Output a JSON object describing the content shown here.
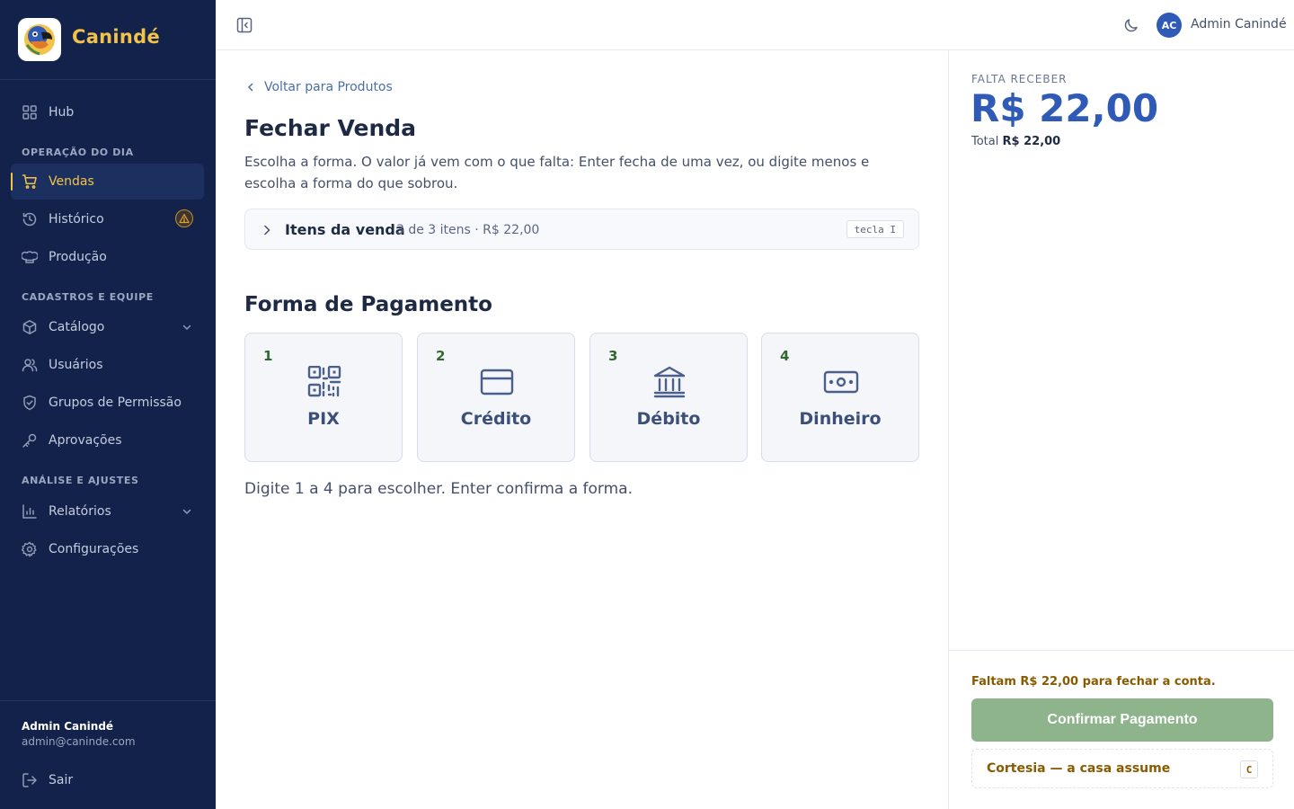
{
  "sidebar": {
    "brand": "Canindé",
    "items": {
      "hub": "Hub",
      "vendas": "Vendas",
      "historico": "Histórico",
      "producao": "Produção",
      "catalogo": "Catálogo",
      "usuarios": "Usuários",
      "grupos": "Grupos de Permissão",
      "aprovacoes": "Aprovações",
      "relatorios": "Relatórios",
      "configuracoes": "Configurações"
    },
    "sections": {
      "operacao": "OPERAÇÃO DO DIA",
      "cadastros": "CADASTROS E EQUIPE",
      "analise": "ANÁLISE E AJUSTES"
    },
    "active_item": "Vendas",
    "footer": {
      "user_name": "Admin Canindé",
      "user_email": "admin@caninde.com",
      "logout": "Sair"
    }
  },
  "topbar": {
    "avatar_initials": "AC",
    "user_name": "Admin Canindé"
  },
  "main": {
    "back_link": "Voltar para Produtos",
    "title": "Fechar Venda",
    "description": "Escolha a forma. O valor já vem com o que falta: Enter fecha de uma vez, ou digite menos e escolha a forma do que sobrou.",
    "items_box": {
      "title": "Itens da venda",
      "meta": "3 de 3 itens · R$ 22,00",
      "shortcut": "tecla I"
    },
    "payment_section_title": "Forma de Pagamento",
    "payment_methods": [
      {
        "key": "1",
        "label": "PIX",
        "icon": "qr-code-icon"
      },
      {
        "key": "2",
        "label": "Crédito",
        "icon": "credit-card-icon"
      },
      {
        "key": "3",
        "label": "Débito",
        "icon": "bank-icon"
      },
      {
        "key": "4",
        "label": "Dinheiro",
        "icon": "banknote-icon"
      }
    ],
    "hint": "Digite 1 a 4 para escolher. Enter confirma a forma."
  },
  "summary": {
    "due_label": "FALTA RECEBER",
    "due_amount": "R$ 22,00",
    "total_label": "Total",
    "total_value": "R$ 22,00",
    "remaining_message": "Faltam R$ 22,00 para fechar a conta.",
    "confirm_button": "Confirmar Pagamento",
    "courtesy_button": "Cortesia — a casa assume",
    "courtesy_shortcut": "C"
  },
  "colors": {
    "sidebar_bg": "#13224a",
    "accent_yellow": "#f2c24b",
    "primary_blue": "#2f5bb7",
    "confirm_disabled_green": "#8db48a",
    "warning_text": "#8a5a00"
  }
}
